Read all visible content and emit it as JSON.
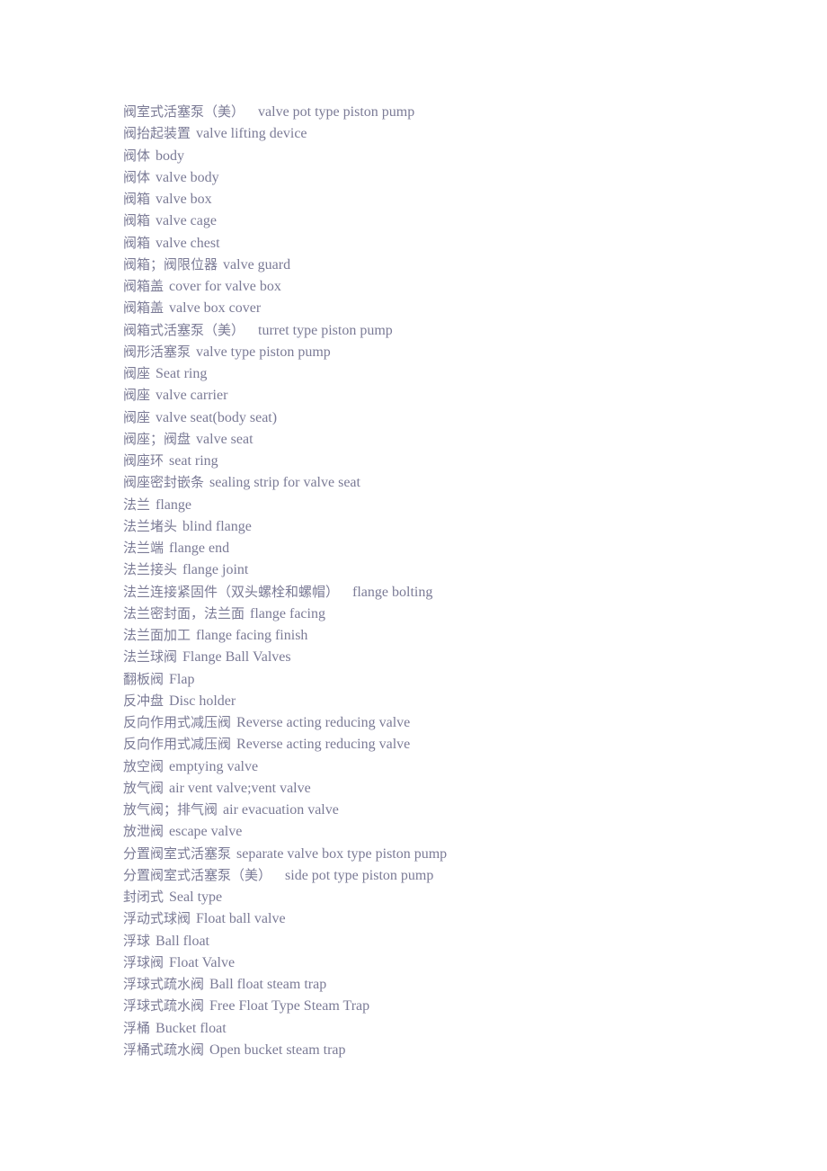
{
  "document": {
    "type": "glossary",
    "language_pair": "Chinese-English",
    "subject": "valve and pump terminology",
    "background_color": "#ffffff",
    "text_color": "#7b7b96",
    "entry_count": 44,
    "entries": [
      {
        "term": "阀室式活塞泵（美）",
        "gloss": "valve pot type piston pump",
        "wide_gap": true
      },
      {
        "term": "阀抬起装置",
        "gloss": "valve lifting device",
        "wide_gap": false
      },
      {
        "term": "阀体",
        "gloss": "body",
        "wide_gap": false
      },
      {
        "term": "阀体",
        "gloss": "valve body",
        "wide_gap": false
      },
      {
        "term": "阀箱",
        "gloss": "valve box",
        "wide_gap": false
      },
      {
        "term": "阀箱",
        "gloss": "valve cage",
        "wide_gap": false
      },
      {
        "term": "阀箱",
        "gloss": "valve chest",
        "wide_gap": false
      },
      {
        "term": "阀箱；阀限位器",
        "gloss": "valve guard",
        "wide_gap": false
      },
      {
        "term": "阀箱盖",
        "gloss": "cover for valve box",
        "wide_gap": false
      },
      {
        "term": "阀箱盖",
        "gloss": "valve box cover",
        "wide_gap": false
      },
      {
        "term": "阀箱式活塞泵（美）",
        "gloss": "turret type piston pump",
        "wide_gap": true
      },
      {
        "term": "阀形活塞泵",
        "gloss": "valve type piston pump",
        "wide_gap": false
      },
      {
        "term": "阀座",
        "gloss": "Seat ring",
        "wide_gap": false
      },
      {
        "term": "阀座",
        "gloss": "valve carrier",
        "wide_gap": false
      },
      {
        "term": "阀座",
        "gloss": "valve seat(body seat)",
        "wide_gap": false
      },
      {
        "term": "阀座；阀盘",
        "gloss": "valve seat",
        "wide_gap": false
      },
      {
        "term": "阀座环",
        "gloss": "seat ring",
        "wide_gap": false
      },
      {
        "term": "阀座密封嵌条",
        "gloss": "sealing strip for valve seat",
        "wide_gap": false
      },
      {
        "term": "法兰",
        "gloss": "flange",
        "wide_gap": false
      },
      {
        "term": "法兰堵头",
        "gloss": "blind flange",
        "wide_gap": false
      },
      {
        "term": "法兰端",
        "gloss": "flange end",
        "wide_gap": false
      },
      {
        "term": "法兰接头",
        "gloss": "flange joint",
        "wide_gap": false
      },
      {
        "term": "法兰连接紧固件（双头螺栓和螺帽）",
        "gloss": "flange bolting",
        "wide_gap": true
      },
      {
        "term": "法兰密封面，法兰面",
        "gloss": "flange facing",
        "wide_gap": false
      },
      {
        "term": "法兰面加工",
        "gloss": "flange facing finish",
        "wide_gap": false
      },
      {
        "term": "法兰球阀",
        "gloss": "Flange Ball Valves",
        "wide_gap": false
      },
      {
        "term": "翻板阀",
        "gloss": "Flap",
        "wide_gap": false
      },
      {
        "term": "反冲盘",
        "gloss": "Disc holder",
        "wide_gap": false
      },
      {
        "term": "反向作用式减压阀",
        "gloss": "Reverse acting reducing valve",
        "wide_gap": false
      },
      {
        "term": "反向作用式减压阀",
        "gloss": "Reverse acting reducing valve",
        "wide_gap": false
      },
      {
        "term": "放空阀",
        "gloss": "emptying valve",
        "wide_gap": false
      },
      {
        "term": "放气阀",
        "gloss": "air vent valve;vent valve",
        "wide_gap": false
      },
      {
        "term": "放气阀；排气阀",
        "gloss": "air evacuation valve",
        "wide_gap": false
      },
      {
        "term": "放泄阀",
        "gloss": "escape valve",
        "wide_gap": false
      },
      {
        "term": "分置阀室式活塞泵",
        "gloss": "separate valve box type piston pump",
        "wide_gap": false
      },
      {
        "term": "分置阀室式活塞泵（美）",
        "gloss": "side pot type piston pump",
        "wide_gap": true
      },
      {
        "term": "封闭式",
        "gloss": "Seal type",
        "wide_gap": false
      },
      {
        "term": "浮动式球阀",
        "gloss": "Float ball valve",
        "wide_gap": false
      },
      {
        "term": "浮球",
        "gloss": "Ball float",
        "wide_gap": false
      },
      {
        "term": "浮球阀",
        "gloss": "Float Valve",
        "wide_gap": false
      },
      {
        "term": "浮球式疏水阀",
        "gloss": "Ball float steam trap",
        "wide_gap": false
      },
      {
        "term": "浮球式疏水阀",
        "gloss": "Free Float Type Steam Trap",
        "wide_gap": false
      },
      {
        "term": "浮桶",
        "gloss": "Bucket float",
        "wide_gap": false
      },
      {
        "term": "浮桶式疏水阀",
        "gloss": "Open bucket steam trap",
        "wide_gap": false
      }
    ]
  }
}
